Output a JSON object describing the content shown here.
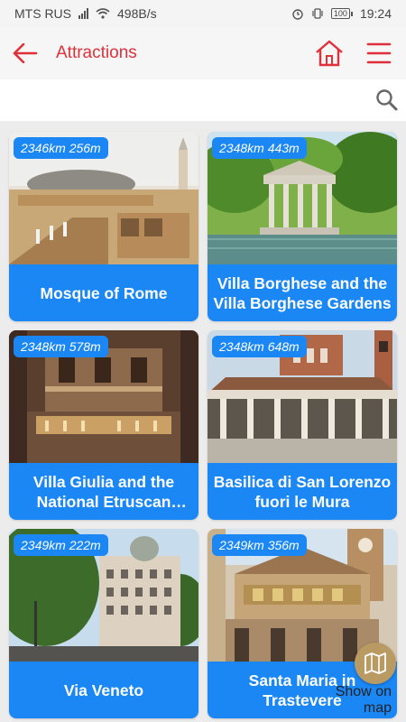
{
  "status": {
    "carrier": "MTS RUS",
    "speed": "498B/s",
    "battery": "100",
    "time": "19:24"
  },
  "appbar": {
    "title": "Attractions"
  },
  "search": {
    "placeholder": ""
  },
  "cards": [
    {
      "distance": "2346km 256m",
      "name": "Mosque of Rome"
    },
    {
      "distance": "2348km 443m",
      "name": "Villa Borghese and the Villa Borghese Gardens"
    },
    {
      "distance": "2348km 578m",
      "name": "Villa Giulia and the National Etruscan Museum"
    },
    {
      "distance": "2348km 648m",
      "name": "Basilica di San Lorenzo fuori le Mura"
    },
    {
      "distance": "2349km 222m",
      "name": "Via Veneto"
    },
    {
      "distance": "2349km 356m",
      "name": "Santa Maria in Trastevere"
    }
  ],
  "map_button": {
    "label": "Show on map"
  },
  "colors": {
    "accent_red": "#e0303a",
    "card_blue": "#1a87f5",
    "map_button": "#b99a63"
  }
}
